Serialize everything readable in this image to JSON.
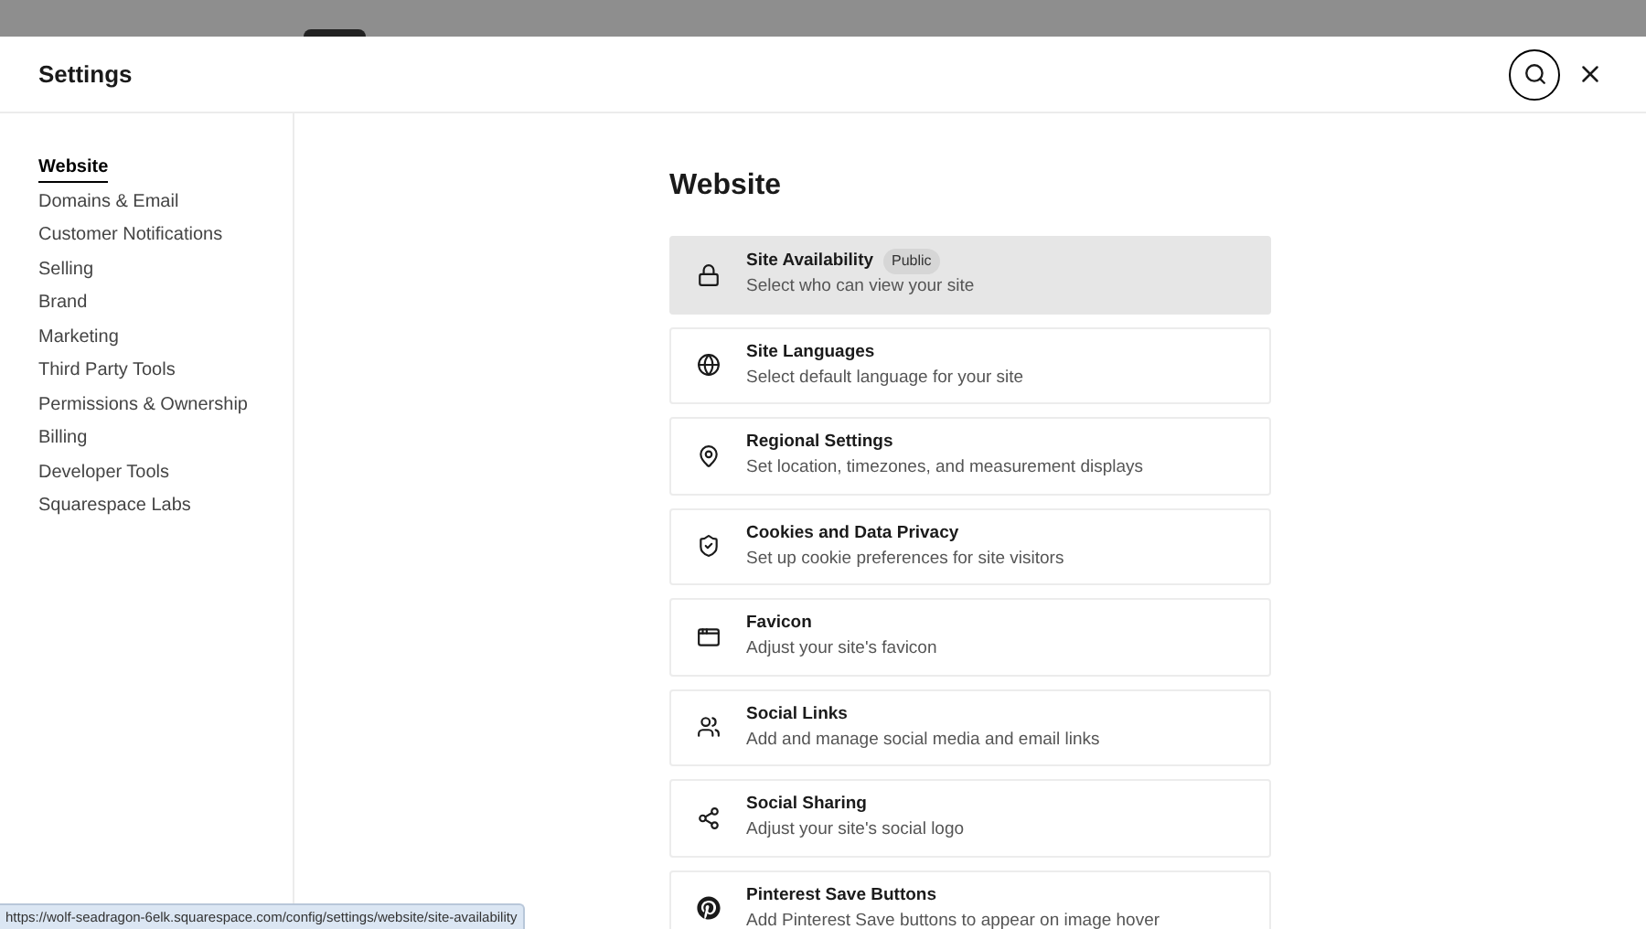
{
  "header": {
    "title": "Settings"
  },
  "sidebar": {
    "items": [
      {
        "label": "Website",
        "selected": true
      },
      {
        "label": "Domains & Email",
        "selected": false
      },
      {
        "label": "Customer Notifications",
        "selected": false
      },
      {
        "label": "Selling",
        "selected": false
      },
      {
        "label": "Brand",
        "selected": false
      },
      {
        "label": "Marketing",
        "selected": false
      },
      {
        "label": "Third Party Tools",
        "selected": false
      },
      {
        "label": "Permissions & Ownership",
        "selected": false
      },
      {
        "label": "Billing",
        "selected": false
      },
      {
        "label": "Developer Tools",
        "selected": false
      },
      {
        "label": "Squarespace Labs",
        "selected": false
      }
    ]
  },
  "main": {
    "heading": "Website",
    "cards": [
      {
        "title": "Site Availability",
        "badge": "Public",
        "description": "Select who can view your site",
        "highlighted": true
      },
      {
        "title": "Site Languages",
        "description": "Select default language for your site",
        "highlighted": false
      },
      {
        "title": "Regional Settings",
        "description": "Set location, timezones, and measurement displays",
        "highlighted": false
      },
      {
        "title": "Cookies and Data Privacy",
        "description": "Set up cookie preferences for site visitors",
        "highlighted": false
      },
      {
        "title": "Favicon",
        "description": "Adjust your site's favicon",
        "highlighted": false
      },
      {
        "title": "Social Links",
        "description": "Add and manage social media and email links",
        "highlighted": false
      },
      {
        "title": "Social Sharing",
        "description": "Adjust your site's social logo",
        "highlighted": false
      },
      {
        "title": "Pinterest Save Buttons",
        "description": "Add Pinterest Save buttons to appear on image hover",
        "highlighted": false
      }
    ]
  },
  "status_bar": {
    "url": "https://wolf-seadragon-6elk.squarespace.com/config/settings/website/site-availability"
  }
}
